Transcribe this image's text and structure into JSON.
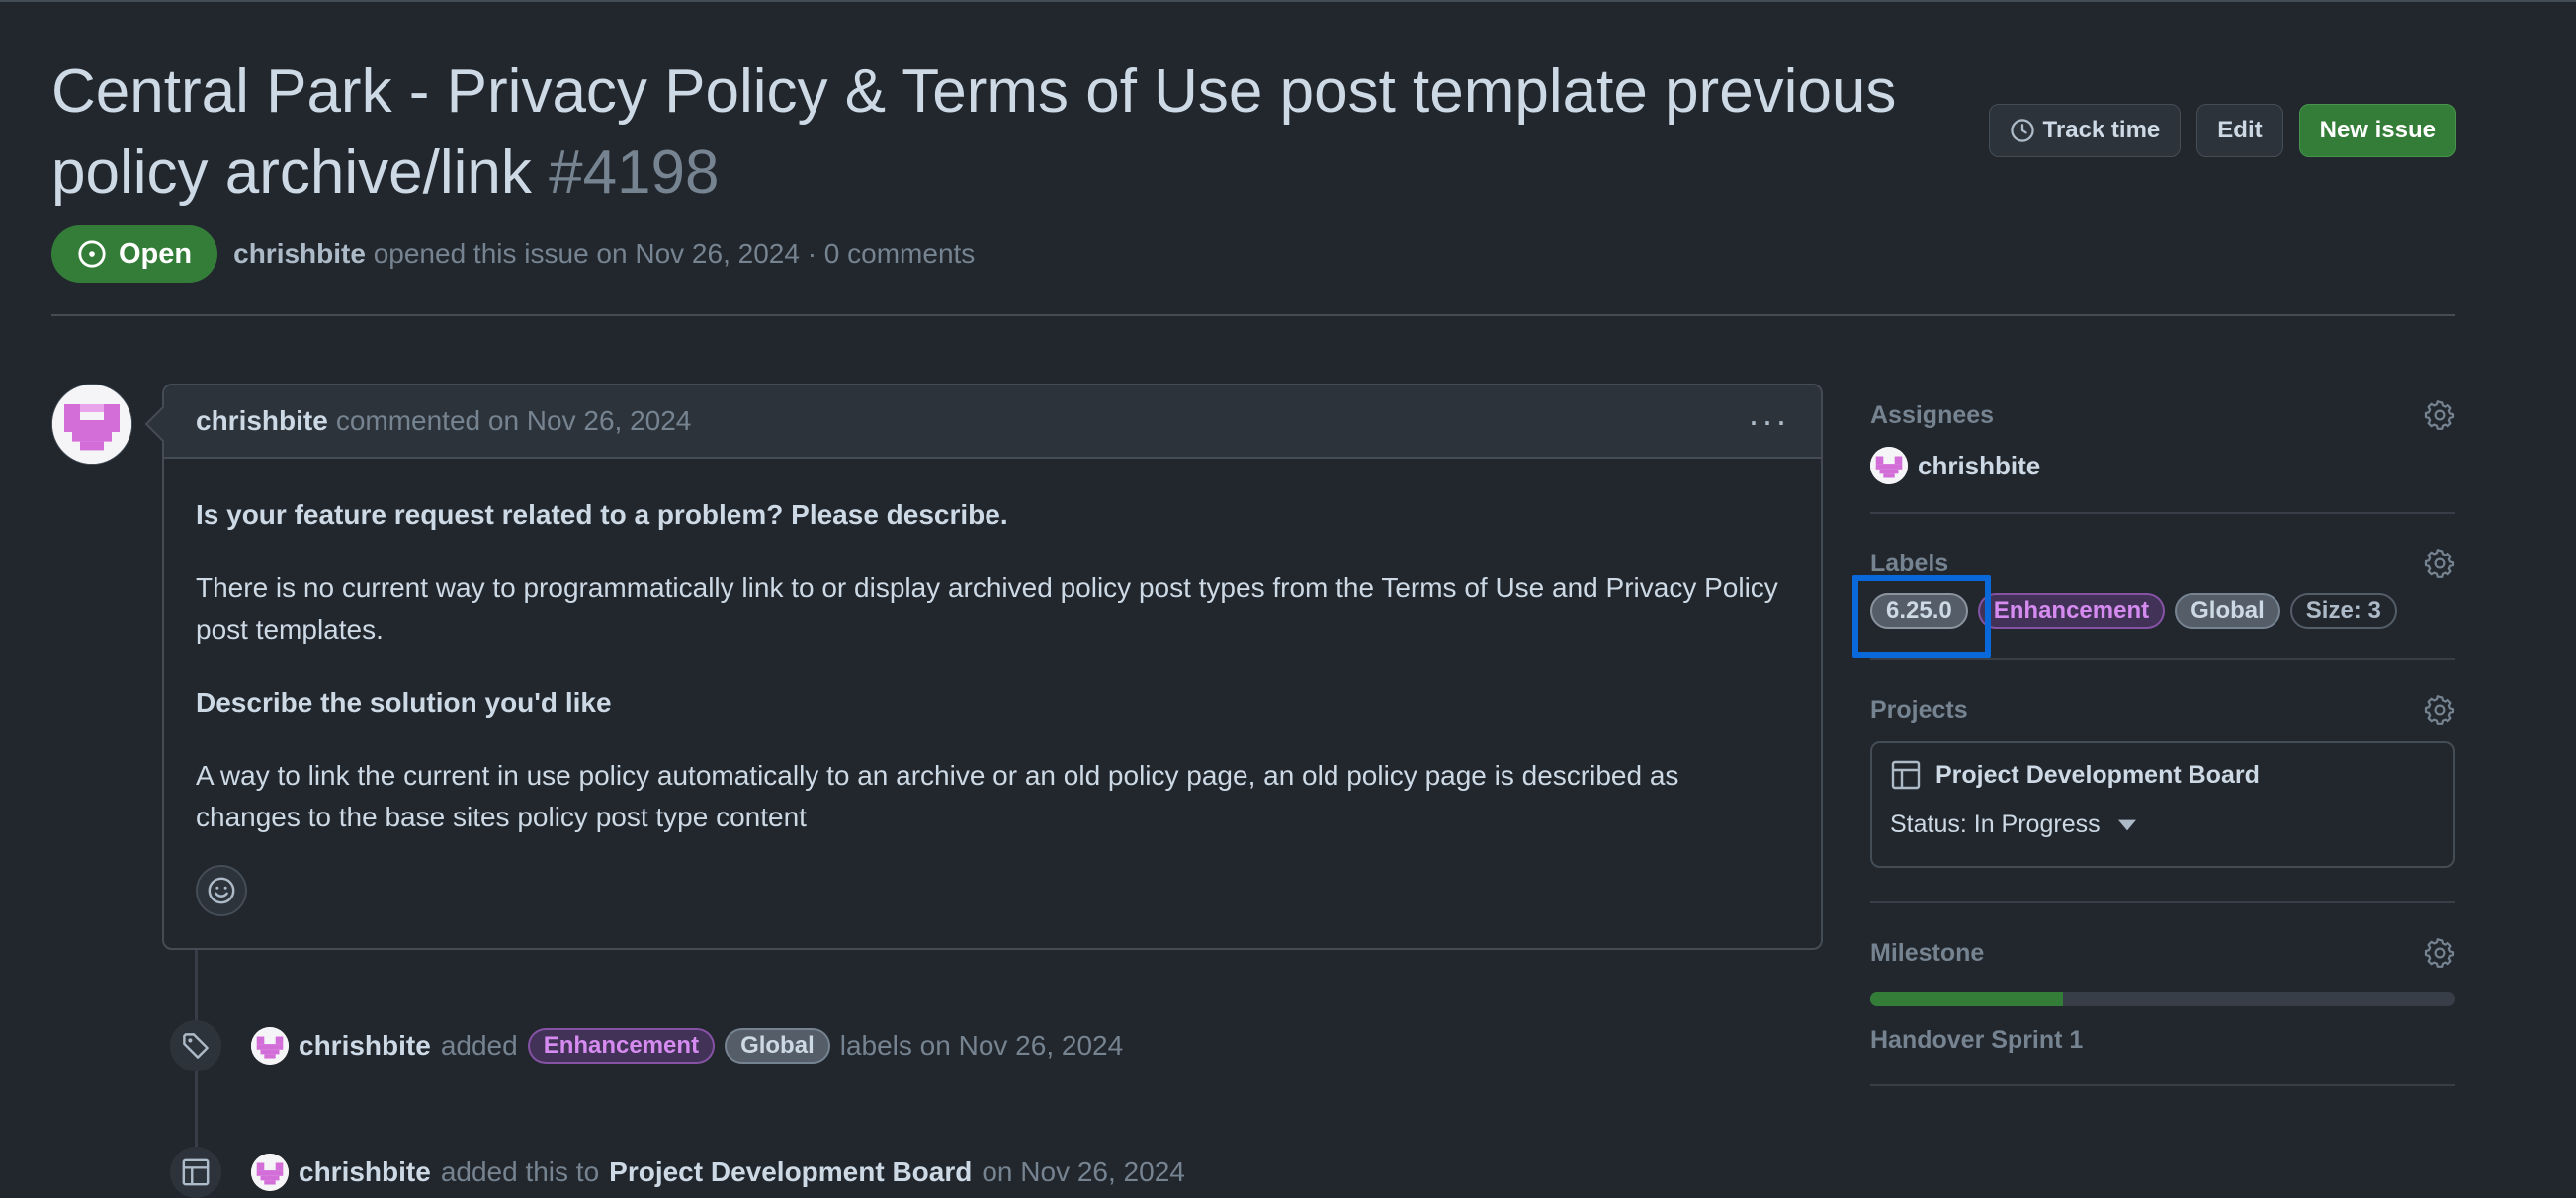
{
  "issue": {
    "title": "Central Park - Privacy Policy & Terms of Use post template previous policy archive/link",
    "number": "#4198",
    "state": "Open",
    "author": "chrishbite",
    "opened_text": "opened this issue on Nov 26, 2024 · 0 comments"
  },
  "header_actions": {
    "track_time": "Track time",
    "edit": "Edit",
    "new_issue": "New issue"
  },
  "comment": {
    "author": "chrishbite",
    "meta": "commented on Nov 26, 2024",
    "menu": "···",
    "body": {
      "q1": "Is your feature request related to a problem? Please describe.",
      "p1": "There is no current way to programmatically link to or display archived policy post types from the Terms of Use and Privacy Policy post templates.",
      "q2": "Describe the solution you'd like",
      "p2": "A way to link the current in use policy automatically to an archive or an old policy page, an old policy page is described as changes to the base sites policy post type content"
    }
  },
  "timeline": [
    {
      "icon": "tag-icon",
      "actor": "chrishbite",
      "verb": "added",
      "labels": [
        "Enhancement",
        "Global"
      ],
      "suffix": "labels on Nov 26, 2024"
    },
    {
      "icon": "table-icon",
      "actor": "chrishbite",
      "verb": "added this to",
      "target": "Project Development Board",
      "suffix": "on Nov 26, 2024"
    }
  ],
  "sidebar": {
    "assignees": {
      "heading": "Assignees",
      "user": "chrishbite"
    },
    "labels": {
      "heading": "Labels",
      "items": [
        "6.25.0",
        "Enhancement",
        "Global",
        "Size: 3"
      ]
    },
    "projects": {
      "heading": "Projects",
      "name": "Project Development Board",
      "status": "Status: In Progress"
    },
    "milestone": {
      "heading": "Milestone",
      "name": "Handover Sprint 1",
      "progress_percent": 33
    }
  },
  "colors": {
    "background": "#22272e",
    "open_green": "#347d39",
    "enhancement": "#d58bf0",
    "focus_outline": "#0969da"
  }
}
